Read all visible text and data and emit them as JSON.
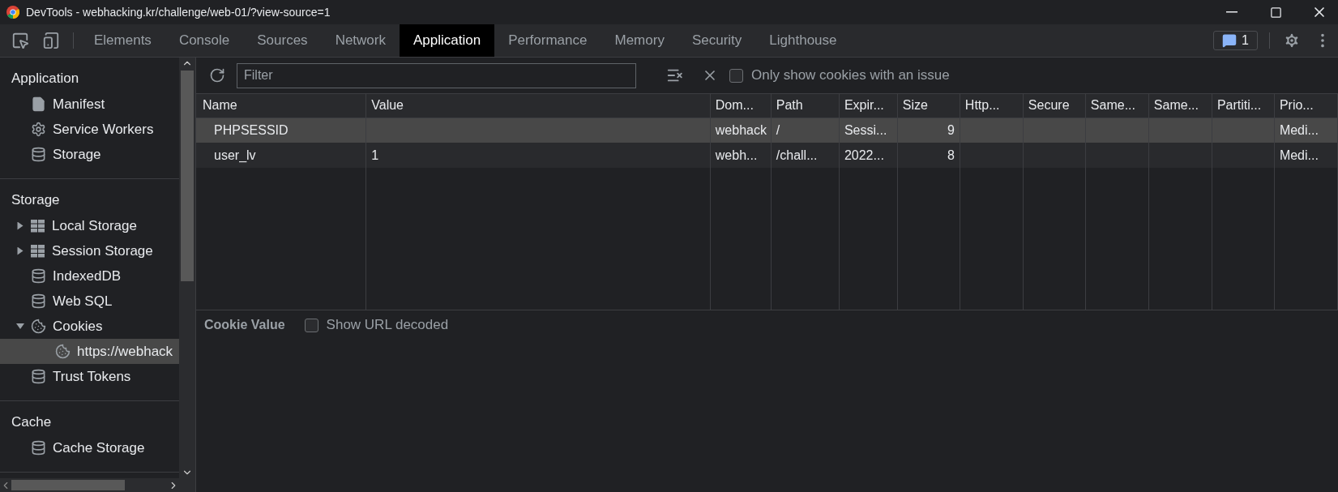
{
  "window": {
    "title": "DevTools - webhacking.kr/challenge/web-01/?view-source=1"
  },
  "tabs": [
    {
      "label": "Elements",
      "selected": false
    },
    {
      "label": "Console",
      "selected": false
    },
    {
      "label": "Sources",
      "selected": false
    },
    {
      "label": "Network",
      "selected": false
    },
    {
      "label": "Application",
      "selected": true
    },
    {
      "label": "Performance",
      "selected": false
    },
    {
      "label": "Memory",
      "selected": false
    },
    {
      "label": "Security",
      "selected": false
    },
    {
      "label": "Lighthouse",
      "selected": false
    }
  ],
  "issues_badge": {
    "count": "1"
  },
  "sidebar": {
    "sections": [
      {
        "title": "Application",
        "items": [
          {
            "label": "Manifest",
            "kind": "file",
            "selected": false
          },
          {
            "label": "Service Workers",
            "kind": "gear",
            "selected": false
          },
          {
            "label": "Storage",
            "kind": "database",
            "selected": false
          }
        ]
      },
      {
        "title": "Storage",
        "items": [
          {
            "label": "Local Storage",
            "kind": "grid",
            "selected": false,
            "expanded": false
          },
          {
            "label": "Session Storage",
            "kind": "grid",
            "selected": false,
            "expanded": false
          },
          {
            "label": "IndexedDB",
            "kind": "database",
            "selected": false
          },
          {
            "label": "Web SQL",
            "kind": "database",
            "selected": false
          },
          {
            "label": "Cookies",
            "kind": "cookie",
            "selected": false,
            "expanded": true,
            "children": [
              {
                "label": "https://webhack",
                "kind": "cookie",
                "selected": true
              }
            ]
          },
          {
            "label": "Trust Tokens",
            "kind": "database",
            "selected": false
          }
        ]
      },
      {
        "title": "Cache",
        "items": [
          {
            "label": "Cache Storage",
            "kind": "database",
            "selected": false
          }
        ]
      }
    ]
  },
  "toolbar": {
    "filter": {
      "placeholder": "Filter"
    },
    "only_issues": {
      "label": "Only show cookies with an issue",
      "checked": false
    }
  },
  "table": {
    "columns": [
      "Name",
      "Value",
      "Dom...",
      "Path",
      "Expir...",
      "Size",
      "Http...",
      "Secure",
      "Same...",
      "Same...",
      "Partiti...",
      "Prio..."
    ],
    "rows": [
      {
        "selected": true,
        "cells": [
          "PHPSESSID",
          "",
          "webhack",
          "/",
          "Sessi...",
          "9",
          "",
          "",
          "",
          "",
          "",
          "Medi..."
        ]
      },
      {
        "selected": false,
        "cells": [
          "user_lv",
          "1",
          "webh...",
          "/chall...",
          "2022...",
          "8",
          "",
          "",
          "",
          "",
          "",
          "Medi..."
        ]
      }
    ]
  },
  "cookie_value": {
    "title": "Cookie Value",
    "show_url_decoded": {
      "label": "Show URL decoded",
      "checked": false
    }
  }
}
